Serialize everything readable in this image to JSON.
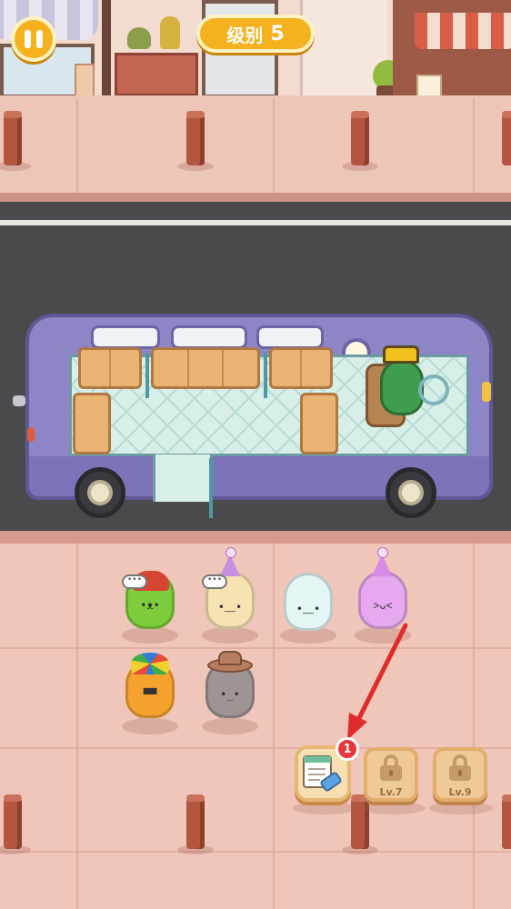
{
  "hud": {
    "pause_icon": "pause-icon",
    "level_label": "级别",
    "level_number": "5"
  },
  "scene": {
    "vehicle": "purple-van",
    "driver": "green-frog-driver",
    "colors": {
      "road": "#4a4a4d",
      "sidewalk": "#efc6b9",
      "van": "#8d85c6",
      "accent_yellow": "#f6b21e"
    }
  },
  "passengers": [
    {
      "id": "green-red-cap",
      "color": "#7ccc3c",
      "face": "•ᴥ•",
      "speech": "•••"
    },
    {
      "id": "cream-party-hat",
      "color": "#f7e3b2",
      "face": "•﹏•",
      "speech": "•••"
    },
    {
      "id": "white-egg",
      "color": "#e3f6f6",
      "face": "•﹏•",
      "speech": ""
    },
    {
      "id": "pink-party-hat",
      "color": "#e6a8ee",
      "face": "˃ᴗ˂",
      "speech": ""
    },
    {
      "id": "orange-jester",
      "color": "#f6a22e",
      "face": "▀▀",
      "speech": ""
    },
    {
      "id": "gray-cowboy",
      "color": "#9e9494",
      "face": "•_•",
      "speech": ""
    }
  ],
  "toolbar": {
    "tool_icon": "clipboard-eraser-icon",
    "badge_count": "1",
    "locked": [
      {
        "icon": "lock-icon",
        "label": "Lv.7"
      },
      {
        "icon": "lock-icon",
        "label": "Lv.9"
      }
    ]
  },
  "hint": {
    "icon": "red-arrow-icon",
    "color": "#e02b2b"
  }
}
